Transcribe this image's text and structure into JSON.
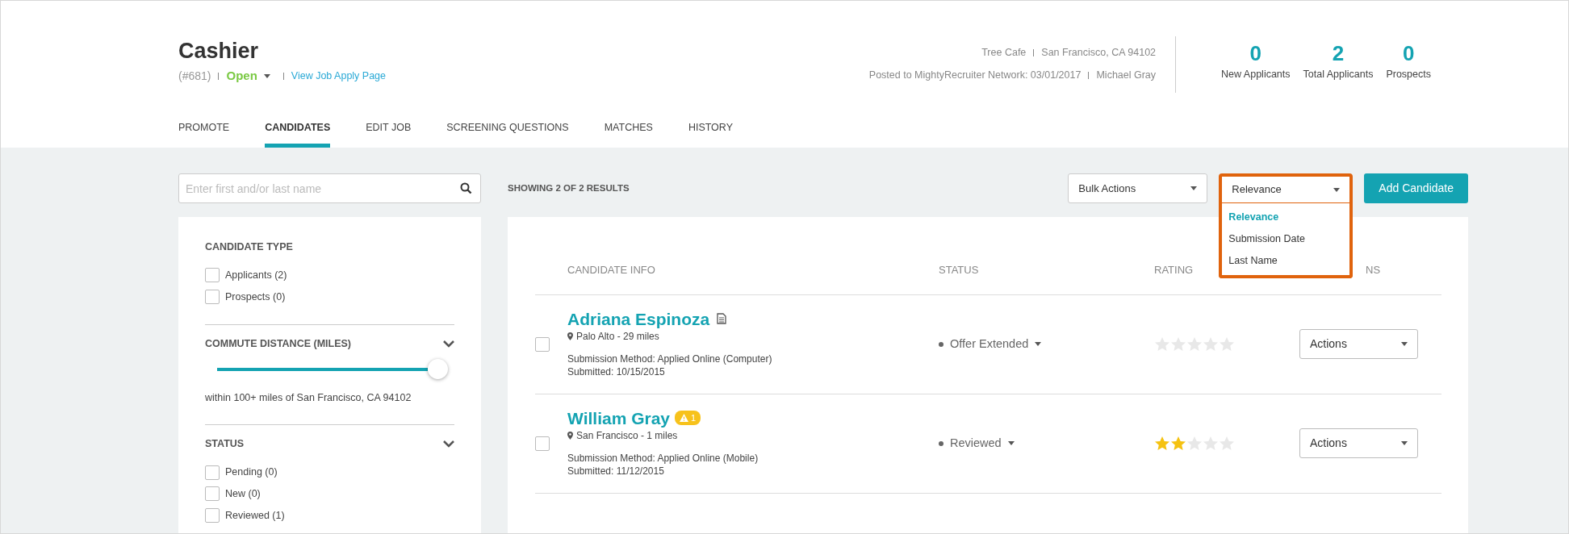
{
  "job": {
    "title": "Cashier",
    "id": "(#681)",
    "status": "Open",
    "apply_link": "View Job Apply Page",
    "company": "Tree Cafe",
    "location": "San Francisco, CA 94102",
    "posted": "Posted to MightyRecruiter Network: 03/01/2017",
    "poster": "Michael Gray"
  },
  "stats": [
    {
      "value": "0",
      "label": "New Applicants"
    },
    {
      "value": "2",
      "label": "Total Applicants"
    },
    {
      "value": "0",
      "label": "Prospects"
    }
  ],
  "tabs": [
    {
      "label": "PROMOTE",
      "selected": false
    },
    {
      "label": "CANDIDATES",
      "selected": true
    },
    {
      "label": "EDIT JOB",
      "selected": false
    },
    {
      "label": "SCREENING QUESTIONS",
      "selected": false
    },
    {
      "label": "MATCHES",
      "selected": false
    },
    {
      "label": "HISTORY",
      "selected": false
    }
  ],
  "search": {
    "placeholder": "Enter first and/or last name"
  },
  "results_text": "SHOWING 2 OF 2 RESULTS",
  "bulk_actions": "Bulk Actions",
  "sort": {
    "value": "Relevance",
    "expanded": true,
    "options": [
      {
        "label": "Relevance",
        "selected": true
      },
      {
        "label": "Submission Date",
        "selected": false
      },
      {
        "label": "Last Name",
        "selected": false
      }
    ]
  },
  "add_button": "Add Candidate",
  "filters": [
    {
      "kind": "checklist",
      "title": "CANDIDATE TYPE",
      "collapsible": false,
      "items": [
        {
          "label": "Applicants (2)",
          "checked": false
        },
        {
          "label": "Prospects (0)",
          "checked": false
        }
      ]
    },
    {
      "kind": "slider",
      "title": "COMMUTE DISTANCE (MILES)",
      "collapsible": true,
      "level": 1,
      "caption": "within 100+ miles of San Francisco, CA 94102"
    },
    {
      "kind": "checklist",
      "title": "STATUS",
      "collapsible": true,
      "items": [
        {
          "label": "Pending (0)",
          "checked": false
        },
        {
          "label": "New (0)",
          "checked": false
        },
        {
          "label": "Reviewed (1)",
          "checked": false
        }
      ]
    }
  ],
  "table": {
    "columns": [
      "CANDIDATE INFO",
      "STATUS",
      "RATING",
      "NS"
    ],
    "rows": [
      {
        "checked": false,
        "name": "Adriana Espinoza",
        "document": true,
        "location": "Palo Alto - 29 miles",
        "method": "Submission Method: Applied Online (Computer)",
        "submitted": "Submitted: 10/15/2015",
        "status": "Offer Extended",
        "stars": 0,
        "actions": "Actions"
      },
      {
        "checked": false,
        "name": "William Gray",
        "document": false,
        "alert": "1",
        "location": "San Francisco - 1 miles",
        "method": "Submission Method: Applied Online (Mobile)",
        "submitted": "Submitted: 11/12/2015",
        "status": "Reviewed",
        "stars": 2,
        "actions": "Actions"
      }
    ]
  }
}
